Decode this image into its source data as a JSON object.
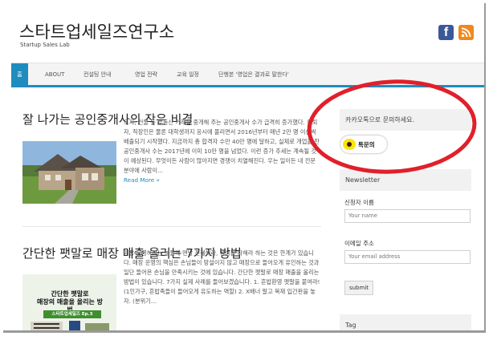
{
  "header": {
    "site_title": "스타트업세일즈연구소",
    "site_description": "Startup Sales Lab",
    "facebook_glyph": "f",
    "brand_colors": {
      "primary": "#1e8cbe",
      "facebook": "#3b5998",
      "rss": "#f0881c",
      "kakao": "#fee500",
      "annotation": "#e0202a"
    }
  },
  "nav": {
    "items": [
      "홈",
      "ABOUT",
      "컨설팅 안내",
      "영업 전략",
      "교육 일정",
      "단행본 '영업은 결과로 말한다'"
    ]
  },
  "posts": [
    {
      "title": "잘 나가는 공인중개사의 작은 비결",
      "excerpt": "토지, 건물 등 부동산 거래를 중개해 주는 공인중개사 수가 급격히 증가했다. 은퇴자, 직장인은 물론 대학생까지 응시에 몰리면서 2016년부터 매년 2만 명 이상씩 배출되기 시작했다. 지금까지 총 합격자 수만 40만 명에 달하고, 실제로 개업을 한 공인중개사 수는 2017년에 이미 10만 명을 넘었다. 이런 증가 추세는 계속될 것이 예상된다. 무엇이든 사람이 많아지면 경쟁이 치열해진다. 우는 일이든 내 전문 분야에 사람이…",
      "read_more": "Read More »"
    },
    {
      "title": "간단한 팻말로 매장 매출 올리는 7가지 방법",
      "excerpt": "매장 운영하시는 분들께 맨날 친절해라, 정성을 다해라 하는 것은 한계가 있습니다. 매장 운영의 핵심은 손님들이 망설이지 않고 매장으로 들어오게 유인하는 것과 일단 들어온 손님을 만족시키는 것에 있습니다. 간단한 팻말로 매장 매출을 올리는 방법이 있습니다. 7가지 실제 사례를 들어보겠습니다. 1. 흔밥환영 팻말을 붙여라! (1인가구, 흔밥족들이 들어오게 유도하는 역할) 2. X배너 말고 목재 입간판을 놓자. (분위기…",
      "thumbnail": {
        "line1": "간단한 팻말로",
        "line2": "매장의 매출을 올리는 방법",
        "tag": "스타트업세일즈 Ep.3"
      }
    }
  ],
  "sidebar": {
    "kakao_prompt": "카카오톡으로 문의하세요.",
    "kakao_button": "톡문의",
    "newsletter_title": "Newsletter",
    "name_label": "신청자 이름",
    "name_placeholder": "Your name",
    "email_label": "이메일 주소",
    "email_placeholder": "Your email address",
    "submit_label": "submit",
    "tag_title": "Tag"
  }
}
